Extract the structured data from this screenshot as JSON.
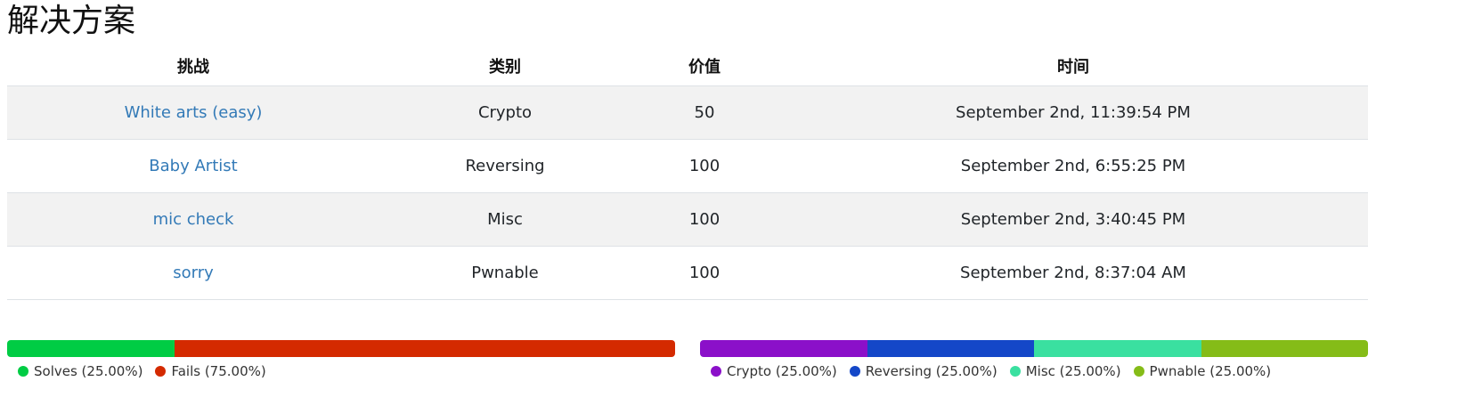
{
  "page": {
    "title": "解决方案"
  },
  "table": {
    "headers": {
      "challenge": "挑战",
      "category": "类别",
      "value": "价值",
      "time": "时间"
    },
    "rows": [
      {
        "challenge": "White arts (easy)",
        "category": "Crypto",
        "value": "50",
        "time": "September 2nd, 11:39:54 PM"
      },
      {
        "challenge": "Baby Artist",
        "category": "Reversing",
        "value": "100",
        "time": "September 2nd, 6:55:25 PM"
      },
      {
        "challenge": "mic check",
        "category": "Misc",
        "value": "100",
        "time": "September 2nd, 3:40:45 PM"
      },
      {
        "challenge": "sorry",
        "category": "Pwnable",
        "value": "100",
        "time": "September 2nd, 8:37:04 AM"
      }
    ]
  },
  "solve_percentages": {
    "legend": [
      {
        "label": "Solves (25.00%)",
        "color": "#00cc44",
        "value": 25
      },
      {
        "label": "Fails (75.00%)",
        "color": "#d42a00",
        "value": 75
      }
    ]
  },
  "category_breakdown": {
    "legend": [
      {
        "label": "Crypto (25.00%)",
        "color": "#8b10c9",
        "value": 25
      },
      {
        "label": "Reversing (25.00%)",
        "color": "#1447c8",
        "value": 25
      },
      {
        "label": "Misc (25.00%)",
        "color": "#3ae0a0",
        "value": 25
      },
      {
        "label": "Pwnable (25.00%)",
        "color": "#85bc18",
        "value": 25
      }
    ]
  }
}
